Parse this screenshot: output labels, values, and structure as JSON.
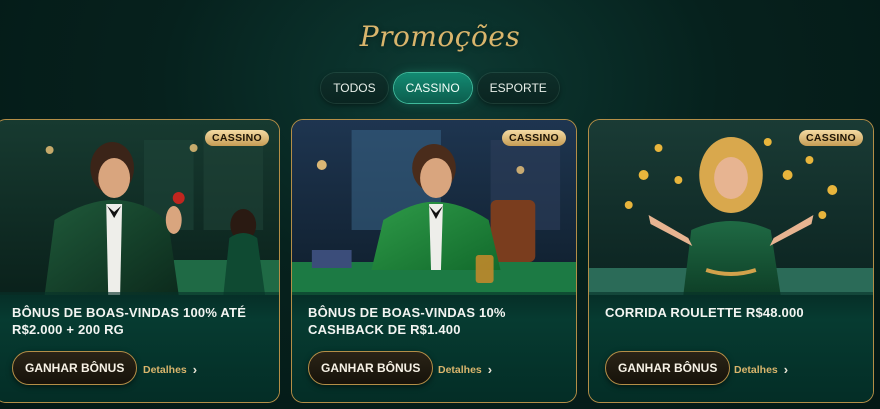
{
  "page": {
    "title": "Promoções"
  },
  "tabs": [
    {
      "label": "TODOS",
      "active": false
    },
    {
      "label": "CASSINO",
      "active": true
    },
    {
      "label": "ESPORTE",
      "active": false
    }
  ],
  "cards": [
    {
      "badge": "CASSINO",
      "title": "BÔNUS DE BOAS-VINDAS 100% ATÉ R$2.000 + 200 RG",
      "button": "GANHAR BÔNUS",
      "details": "Detalhes"
    },
    {
      "badge": "CASSINO",
      "title": "BÔNUS DE BOAS-VINDAS 10% CASHBACK DE R$1.400",
      "button": "GANHAR BÔNUS",
      "details": "Detalhes"
    },
    {
      "badge": "CASSINO",
      "title": "CORRIDA ROULETTE R$48.000",
      "button": "GANHAR BÔNUS",
      "details": "Detalhes"
    }
  ],
  "colors": {
    "background": "#06211d",
    "accent_gold": "#d9b56c",
    "active_tab": "#138a72",
    "card_border": "#b48e47"
  },
  "icons": {
    "details": "chevron-right-icon"
  }
}
